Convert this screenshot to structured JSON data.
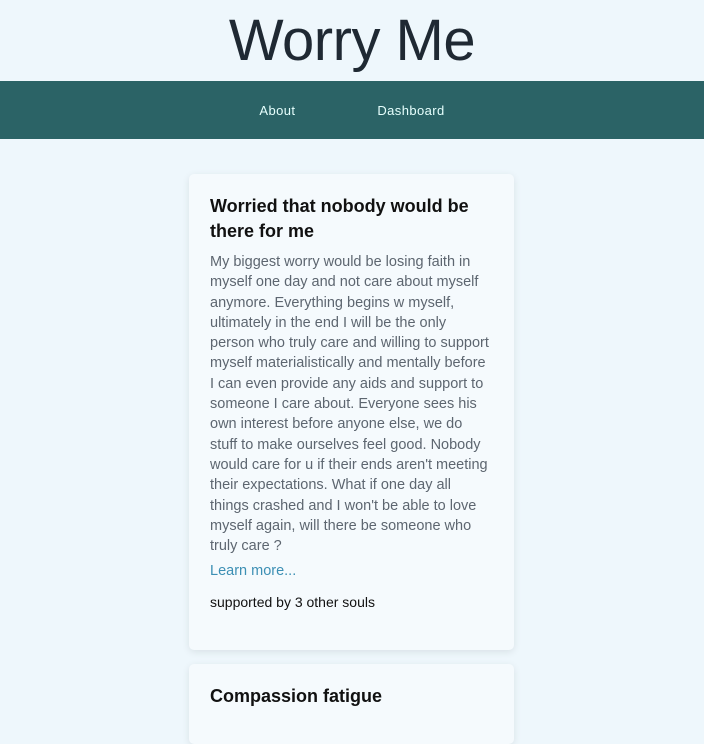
{
  "site": {
    "title": "Worry Me"
  },
  "nav": {
    "items": [
      {
        "label": "About"
      },
      {
        "label": "Dashboard"
      }
    ]
  },
  "posts": [
    {
      "title": "Worried that nobody would be there for me",
      "body": "My biggest worry would be losing faith in myself one day and not care about myself anymore. Everything begins w myself, ultimately in the end I will be the only person who truly care and willing to support myself materialistically and mentally before I can even provide any aids and support to someone I care about. Everyone sees his own interest before anyone else, we do stuff to make ourselves feel good. Nobody would care for u if their ends aren't meeting their expectations. What if one day all things crashed and I won't be able to love myself again, will there be someone who truly care ?",
      "link": "Learn more...",
      "support": "supported by 3 other souls"
    },
    {
      "title": "Compassion fatigue"
    }
  ]
}
